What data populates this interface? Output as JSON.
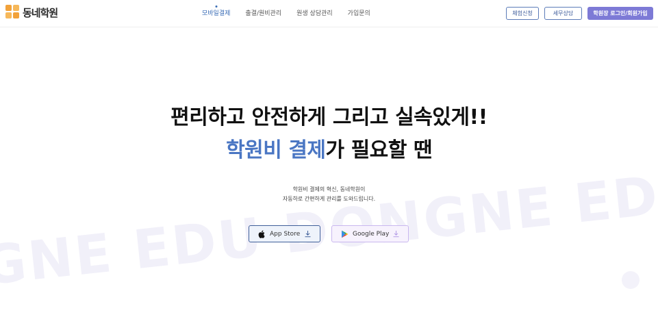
{
  "header": {
    "logo_text": "동네학원",
    "nav": [
      {
        "label": "모바일결제",
        "active": true
      },
      {
        "label": "출결/원비관리",
        "active": false
      },
      {
        "label": "원생 상담관리",
        "active": false
      },
      {
        "label": "가입문의",
        "active": false
      }
    ],
    "buttons": {
      "apply": "체험신청",
      "consult": "세무상담",
      "login": "학원장 로그인/회원가입"
    }
  },
  "hero": {
    "line1": "편리하고 안전하게 그리고 실속있게!!",
    "line2_accent": "학원비 결제",
    "line2_rest": "가 필요할 땐",
    "desc_line1": "학원비 결제의 혁신, 동네학원이",
    "desc_line2": "자동하로 간편하게 관리를 도와드립니다."
  },
  "stores": {
    "app_store": "App Store",
    "google_play": "Google Play"
  },
  "watermark": "GNE EDU DONGNE EDU",
  "colors": {
    "accent": "#4a76c3",
    "logo_orange": "#f2a23a",
    "login_button": "#7d7ad6"
  }
}
